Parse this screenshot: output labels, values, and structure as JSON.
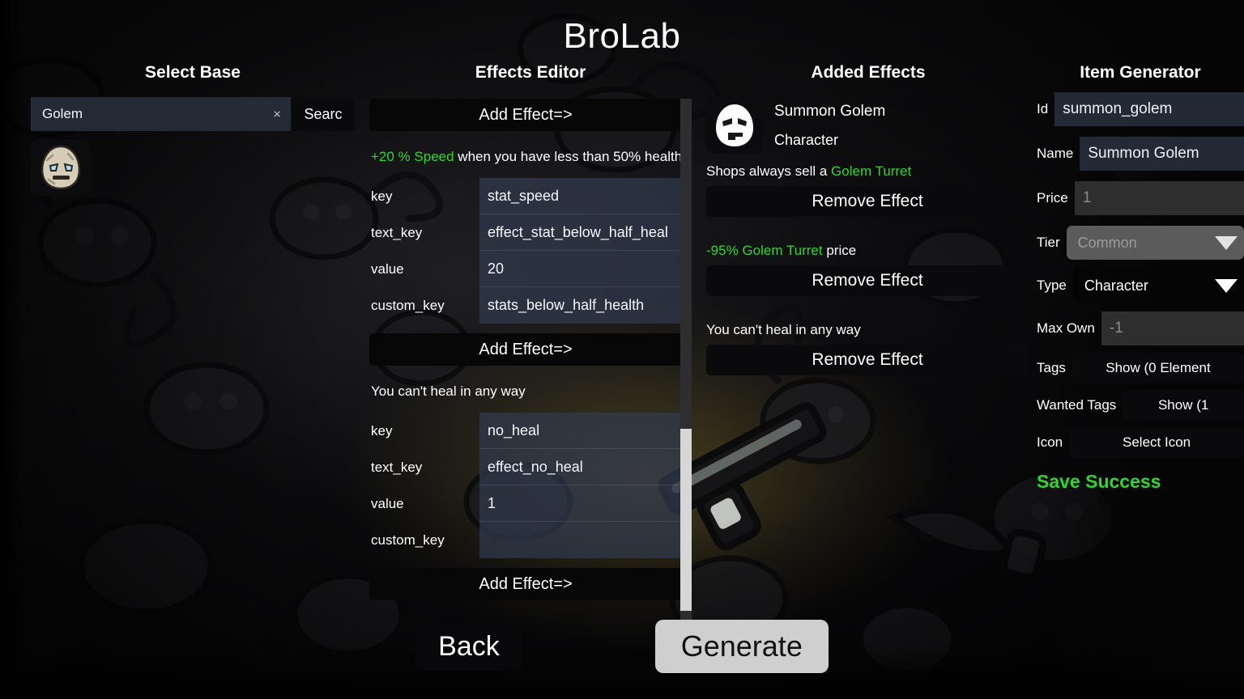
{
  "app": {
    "title": "BroLab"
  },
  "colors": {
    "accent_green": "#2fd62f",
    "input_bg": "#252b36",
    "panel_black": "#0a0a0c",
    "generate_button_bg": "#cfcfcf"
  },
  "select_base": {
    "title": "Select Base",
    "search_value": "Golem",
    "search_placeholder": "Search",
    "clear_icon": "×",
    "search_button_label": "Searc",
    "results": [
      {
        "name": "Golem",
        "icon": "golem-head-icon"
      }
    ]
  },
  "effects_editor": {
    "title": "Effects Editor",
    "add_effect_label": "Add Effect=>",
    "field_labels": {
      "key": "key",
      "text_key": "text_key",
      "value": "value",
      "custom_key": "custom_key"
    },
    "blocks": [
      {
        "description_prefix": "+20 % Speed",
        "description_rest": " when you have less than 50% health",
        "key": "stat_speed",
        "text_key": "effect_stat_below_half_heal",
        "value": "20",
        "custom_key": "stats_below_half_health"
      },
      {
        "description_prefix": "",
        "description_rest": "You can't heal in any way",
        "key": "no_heal",
        "text_key": "effect_no_heal",
        "value": "1",
        "custom_key": ""
      }
    ]
  },
  "added_effects": {
    "title": "Added Effects",
    "item_name": "Summon Golem",
    "item_type": "Character",
    "item_icon": "golem-white-head-icon",
    "remove_label": "Remove Effect",
    "entries": [
      {
        "prefix": "Shops always sell a ",
        "highlight": "Golem Turret",
        "suffix": ""
      },
      {
        "prefix": "",
        "highlight": "-95% Golem Turret",
        "suffix": " price"
      },
      {
        "prefix": "You can't heal in any way",
        "highlight": "",
        "suffix": ""
      }
    ]
  },
  "item_generator": {
    "title": "Item Generator",
    "fields": {
      "id_label": "Id",
      "id_value": "summon_golem",
      "name_label": "Name",
      "name_value": "Summon Golem",
      "price_label": "Price",
      "price_value": "1",
      "tier_label": "Tier",
      "tier_value": "Common",
      "type_label": "Type",
      "type_value": "Character",
      "max_own_label": "Max Own",
      "max_own_value": "-1",
      "tags_label": "Tags",
      "tags_button": "Show (0 Element",
      "wanted_tags_label": "Wanted Tags",
      "wanted_tags_button": "Show (1",
      "icon_label": "Icon",
      "icon_button": "Select Icon"
    },
    "save_status": "Save Success"
  },
  "footer": {
    "back_label": "Back",
    "generate_label": "Generate"
  }
}
